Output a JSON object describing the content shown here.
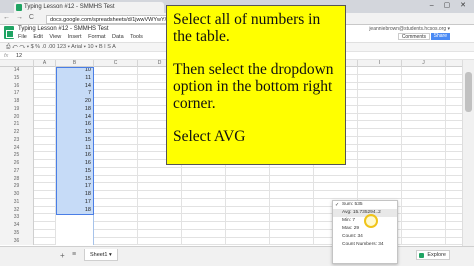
{
  "browser": {
    "tab_title": "Typing Lesson #12 - SMMHS Test",
    "tab_close": "×",
    "window_controls": "– ▢ ✕",
    "nav": "← → C",
    "url": "docs.google.com/spreadsheets/d/1jwwVWYwY/edit#gid=0"
  },
  "sheets": {
    "title": "Typing Lesson #12 - SMMHS Test",
    "menu": [
      "File",
      "Edit",
      "View",
      "Insert",
      "Format",
      "Data",
      "Tools"
    ],
    "toolbar": "⎙ ↶ ↷ ▾  $  %  .0  .00  123 ▾  Arial ▾  10 ▾  B  I  S  A",
    "account": "jeanniebrown@students.hcsos.org ▾",
    "comments_label": "Comments",
    "share_label": "Share",
    "formula_label": "fx",
    "formula_value": "12",
    "column_headers": [
      "",
      "A",
      "B",
      "C",
      "D",
      "E",
      "F",
      "G",
      "H",
      "I",
      "J"
    ],
    "rows": [
      {
        "num": "14",
        "b": "10"
      },
      {
        "num": "15",
        "b": "11"
      },
      {
        "num": "16",
        "b": "14"
      },
      {
        "num": "17",
        "b": "7"
      },
      {
        "num": "18",
        "b": "20"
      },
      {
        "num": "19",
        "b": "18"
      },
      {
        "num": "20",
        "b": "14"
      },
      {
        "num": "21",
        "b": "16"
      },
      {
        "num": "22",
        "b": "13"
      },
      {
        "num": "23",
        "b": "15"
      },
      {
        "num": "24",
        "b": "11"
      },
      {
        "num": "25",
        "b": "16"
      },
      {
        "num": "26",
        "b": "16"
      },
      {
        "num": "27",
        "b": "15"
      },
      {
        "num": "28",
        "b": "15"
      },
      {
        "num": "29",
        "b": "17"
      },
      {
        "num": "30",
        "b": "18"
      },
      {
        "num": "31",
        "b": "17"
      },
      {
        "num": "32",
        "b": "18"
      },
      {
        "num": "33",
        "b": ""
      },
      {
        "num": "34",
        "b": ""
      },
      {
        "num": "35",
        "b": ""
      },
      {
        "num": "36",
        "b": ""
      }
    ],
    "add_sheet": "+",
    "sheets_menu": "≡",
    "sheet_tab": "Sheet1 ▾",
    "explore_label": "Explore"
  },
  "dropdown": {
    "items": [
      {
        "label": "Sum: 535",
        "checked": true
      },
      {
        "label": "Avg: 15.735294..2",
        "checked": false
      },
      {
        "label": "Min: 7",
        "checked": false
      },
      {
        "label": "Max: 29",
        "checked": false
      },
      {
        "label": "Count: 34",
        "checked": false
      },
      {
        "label": "Count Numbers: 34",
        "checked": false
      }
    ]
  },
  "callout": {
    "line1": "Select all of numbers in the table.",
    "line2": "Then select the dropdown option in the bottom right corner.",
    "line3": "Select AVG"
  }
}
